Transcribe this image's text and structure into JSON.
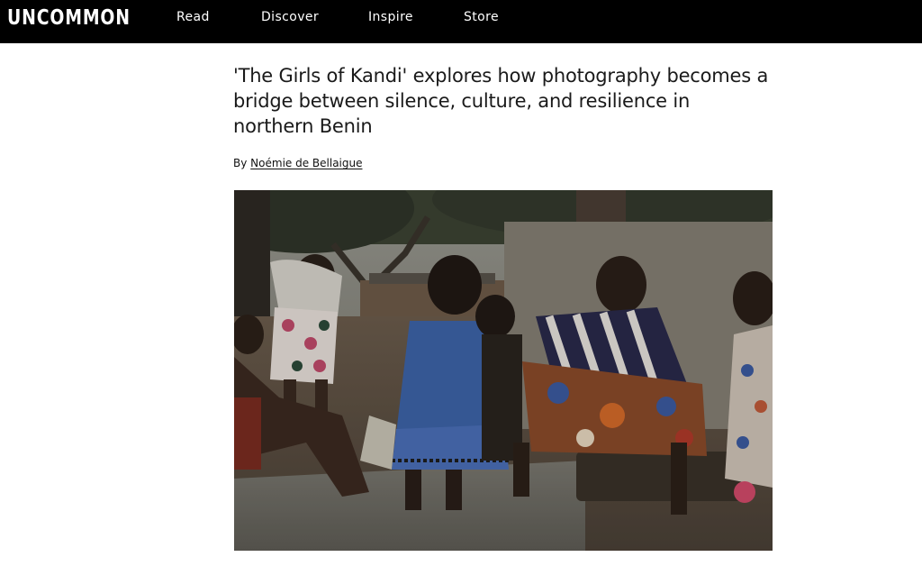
{
  "brand": {
    "logo_text": "UNCOMMON"
  },
  "nav": {
    "items": [
      {
        "label": "Read"
      },
      {
        "label": "Discover"
      },
      {
        "label": "Inspire"
      },
      {
        "label": "Store"
      }
    ]
  },
  "article": {
    "title": "'The Girls of Kandi' explores how photography becomes a bridge between silence, culture, and resilience in northern Benin",
    "byline_prefix": "By",
    "author": "Noémie de Bellaigue"
  },
  "colors": {
    "topbar_bg": "#000000",
    "page_bg": "#ffffff",
    "text": "#1a1a1a"
  }
}
